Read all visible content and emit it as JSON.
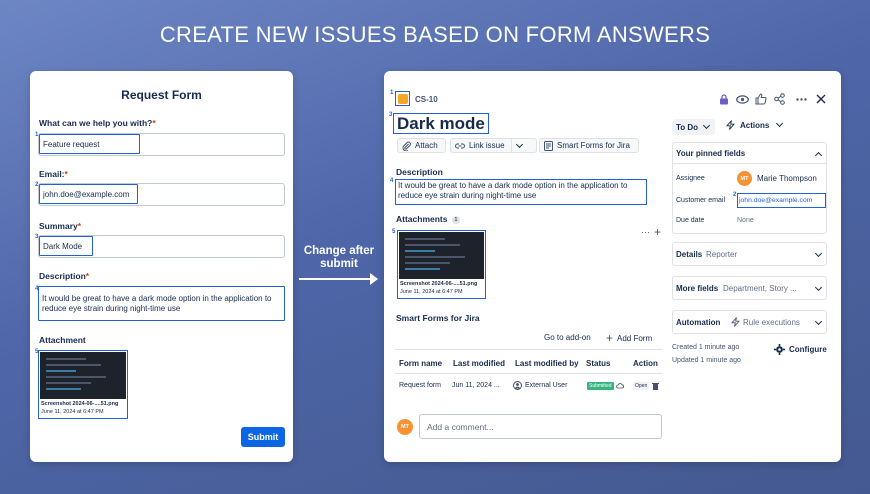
{
  "headline": "CREATE NEW ISSUES BASED ON FORM ANSWERS",
  "form": {
    "title": "Request Form",
    "q1_label": "What can we help you with?",
    "q1_value": "Feature request",
    "email_label": "Email:",
    "email_value": "john.doe@example.com",
    "summary_label": "Summary",
    "summary_value": "Dark Mode",
    "description_label": "Description",
    "description_value": "It would be great to have a dark mode option in the application to reduce eye strain during night-time use",
    "attachment_label": "Attachment",
    "attachment_name": "Screenshot 2024-06-....51.png",
    "attachment_date": "June 11, 2024 at 6:47 PM",
    "submit_label": "Submit",
    "req_mark": "*",
    "nums": [
      "1",
      "2",
      "3",
      "4",
      "5"
    ]
  },
  "arrow": {
    "text_line1": "Change after",
    "text_line2": "submit"
  },
  "issue": {
    "key": "CS-10",
    "title": "Dark mode",
    "toolbar": {
      "attach": "Attach",
      "link_issue": "Link issue",
      "smart_forms": "Smart Forms for Jira"
    },
    "description_label": "Description",
    "description_value": "It would be great to have a dark mode option in the application to reduce eye strain during night-time use",
    "attachments_label": "Attachments",
    "attachments_count": "1",
    "attachment_name": "Screenshot 2024-06-....51.png",
    "attachment_date": "June 11, 2024 at 6:47 PM",
    "smart_forms_label": "Smart Forms for Jira",
    "go_to_addon": "Go to add-on",
    "add_form": "Add Form",
    "table": {
      "headers": [
        "Form name",
        "Last modified",
        "Last modified by",
        "Status",
        "Action"
      ],
      "row": {
        "name": "Request form",
        "modified": "Jun 11, 2024 ...",
        "by": "External User",
        "status": "Submitted",
        "action": "Open"
      }
    },
    "comment_placeholder": "Add a comment...",
    "avatar_initials": "MT",
    "nums": [
      "1",
      "3",
      "4",
      "5"
    ]
  },
  "sidebar": {
    "status": "To Do",
    "actions": "Actions",
    "pinned_title": "Your pinned fields",
    "assignee_label": "Assignee",
    "assignee_value": "Marie Thompson",
    "assignee_initials": "MT",
    "customer_email_label": "Customer email",
    "customer_email_value": "john.doe@example.com",
    "customer_email_num": "2",
    "due_date_label": "Due date",
    "due_date_value": "None",
    "details_label": "Details",
    "details_value": "Reporter",
    "more_fields_label": "More fields",
    "more_fields_value": "Department, Story ...",
    "automation_label": "Automation",
    "automation_value": "Rule executions",
    "created": "Created 1 minute ago",
    "updated": "Updated 1 minute ago",
    "configure": "Configure"
  },
  "colors": {
    "accent": "#2062d6",
    "submit": "#0c66e4",
    "avatar": "#f79232",
    "issue_icon": "#f5a623",
    "lock": "#6e5dc6"
  }
}
